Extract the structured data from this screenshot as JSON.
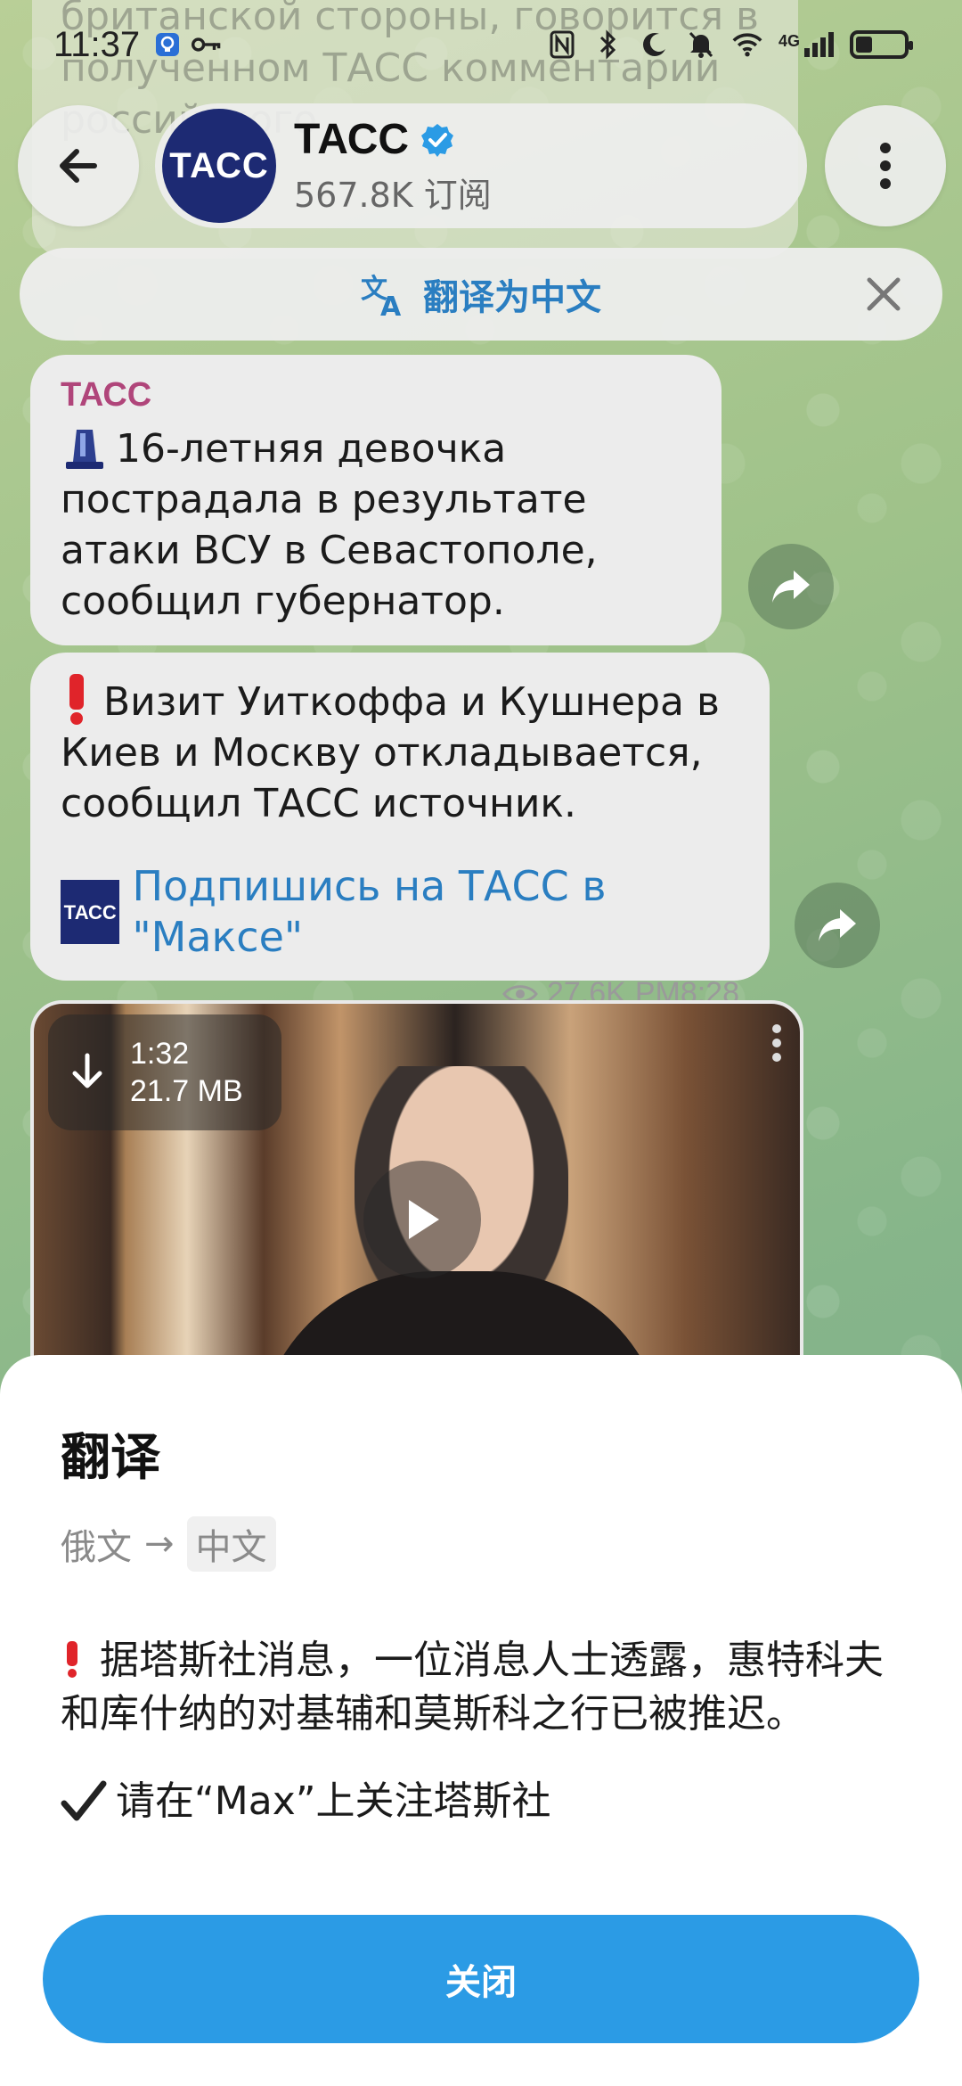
{
  "status_bar": {
    "time": "11:37",
    "network_label": "4G",
    "battery_percent": 35
  },
  "background_message": {
    "text": "британской стороны, говорится в полученном ТАСС комментарии российского"
  },
  "header": {
    "channel_name": "ТАСС",
    "avatar_label": "ТАСС",
    "subscribers": "567.8K 订阅"
  },
  "translate_bar": {
    "label": "翻译为中文"
  },
  "messages": [
    {
      "sender": "ТАСС",
      "icon": "siren-emoji",
      "text": "16-летняя девочка пострадала в результате атаки ВСУ в Севастополе, сообщил губернатор."
    },
    {
      "icon": "exclamation-emoji",
      "text": "Визит Уиткоффа и Кушнера в Киев и Москву откладывается, сообщил ТАСС источник.",
      "link_logo": "ТАСС",
      "link_text": "Подпишись на ТАСС в \"Максе\"",
      "views": "27.6K",
      "time": "PM8:28"
    }
  ],
  "video": {
    "duration": "1:32",
    "size": "21.7 MB"
  },
  "sheet": {
    "title": "翻译",
    "source_lang": "俄文",
    "arrow": "→",
    "target_lang": "中文",
    "paragraph1": "据塔斯社消息，一位消息人士透露，惠特科夫和库什纳的对基辅和莫斯科之行已被推迟。",
    "paragraph2": "请在“Max”上关注塔斯社",
    "close_label": "关闭"
  },
  "colors": {
    "accent": "#2b9be5",
    "link": "#2a7ec1",
    "sender": "#b0457a",
    "avatar_bg": "#1d2a73"
  }
}
